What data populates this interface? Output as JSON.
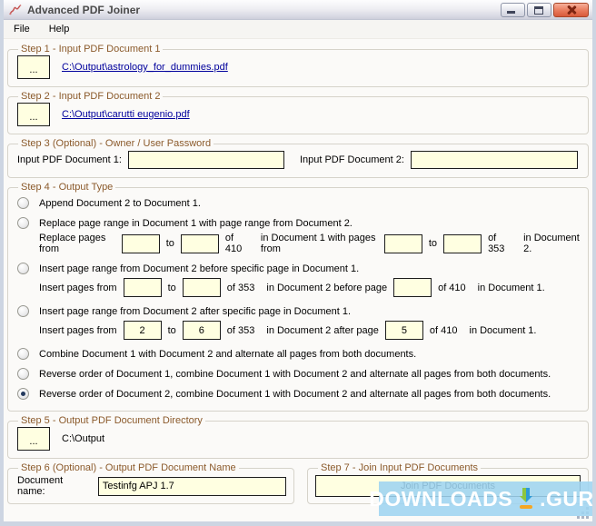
{
  "window": {
    "title": "Advanced PDF Joiner"
  },
  "menu": {
    "items": [
      {
        "label": "File"
      },
      {
        "label": "Help"
      }
    ]
  },
  "colors": {
    "group_title": "#8B5A2B",
    "link": "#00009C",
    "input_bg": "#FFFFE1",
    "watermark_band": "#9ED4F0",
    "close_button": "#E8795B"
  },
  "icons": {
    "app": "red-squiggle",
    "watermark": "download-arrow"
  },
  "steps": {
    "step1": {
      "title": "Step 1 - Input PDF Document 1",
      "browse": "...",
      "file": "C:\\Output\\astrology_for_dummies.pdf"
    },
    "step2": {
      "title": "Step 2 - Input PDF Document 2",
      "browse": "...",
      "file": "C:\\Output\\carutti eugenio.pdf"
    },
    "step3": {
      "title": "Step 3 (Optional) - Owner / User Password",
      "doc1_label": "Input PDF Document 1:",
      "doc1_value": "",
      "doc2_label": "Input PDF Document 2:",
      "doc2_value": ""
    },
    "step4": {
      "title": "Step 4 - Output Type",
      "selected_option": 7,
      "opt1": "Append Document 2 to Document 1.",
      "opt2": "Replace page range in Document 1 with page range from Document 2.",
      "opt2_row": {
        "a": "Replace pages from",
        "from": "",
        "b": "to",
        "to": "",
        "c": "of 410",
        "d": "in Document 1 with pages from",
        "from2": "",
        "e": "to",
        "to2": "",
        "f": "of 353",
        "g": "in Document 2."
      },
      "opt3": "Insert page range from Document 2 before specific page in Document 1.",
      "opt3_row": {
        "a": "Insert pages from",
        "from": "",
        "b": "to",
        "to": "",
        "c": "of 353",
        "d": "in Document 2 before page",
        "page": "",
        "e": "of 410",
        "f": "in Document 1."
      },
      "opt4": "Insert page range from Document 2 after specific page in Document 1.",
      "opt4_row": {
        "a": "Insert pages from",
        "from": "2",
        "b": "to",
        "to": "6",
        "c": "of 353",
        "d": "in Document 2 after page",
        "page": "5",
        "e": "of 410",
        "f": "in Document 1."
      },
      "opt5": "Combine Document 1 with Document 2 and alternate all pages from both documents.",
      "opt6": "Reverse order of Document 1, combine Document 1 with Document 2 and alternate all pages from both documents.",
      "opt7": "Reverse order of Document 2, combine Document 1 with Document 2 and alternate all pages from both documents."
    },
    "step5": {
      "title": "Step 5 - Output PDF Document Directory",
      "browse": "...",
      "directory": "C:\\Output"
    },
    "step6": {
      "title": "Step 6 (Optional) - Output PDF Document Name",
      "label": "Document name:",
      "value": "Testinfg APJ 1.7"
    },
    "step7": {
      "title": "Step 7 - Join Input PDF Documents",
      "button": "Join PDF Documents"
    }
  },
  "watermark": {
    "left": "DOWNLOADS",
    "right": ".GURU"
  }
}
